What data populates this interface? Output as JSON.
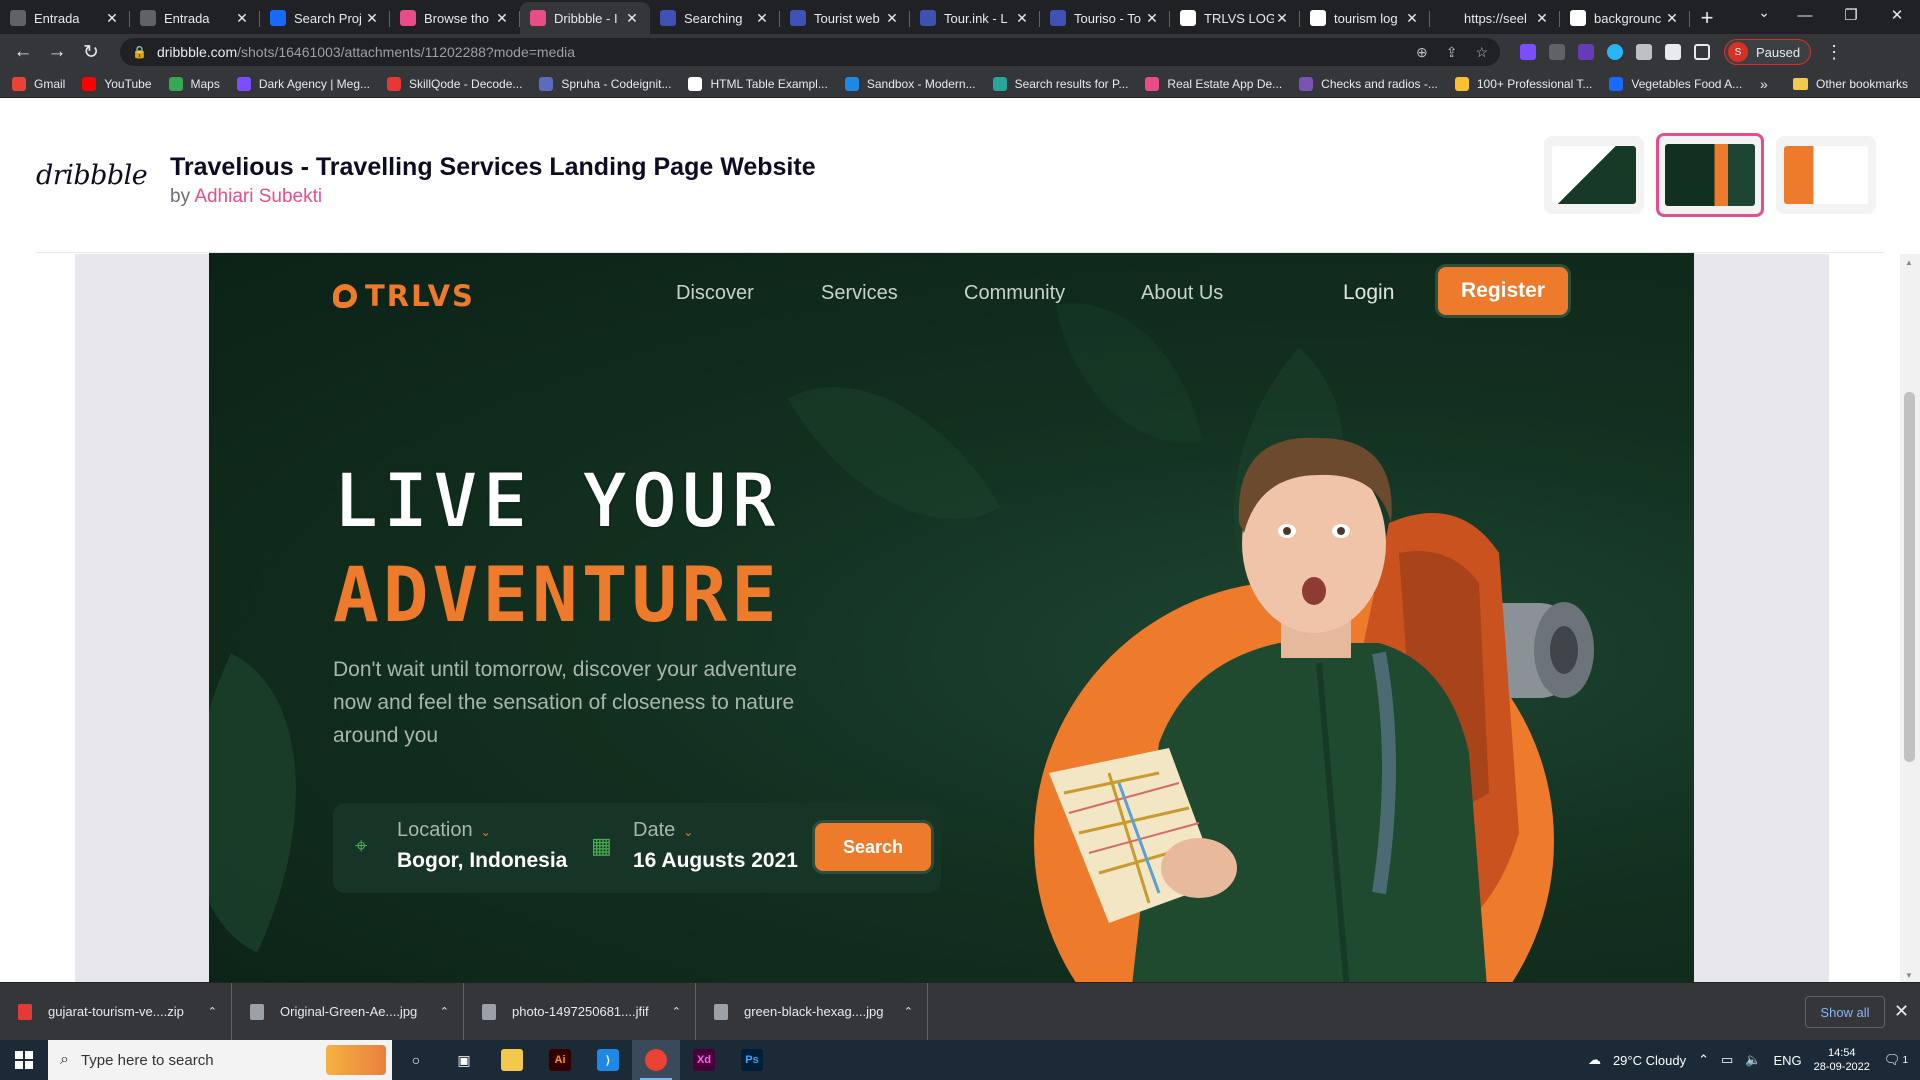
{
  "browser": {
    "tabs": [
      {
        "title": "Entrada",
        "icon": "threads-icon",
        "color": "#5f6368"
      },
      {
        "title": "Entrada",
        "icon": "threads-icon",
        "color": "#5f6368"
      },
      {
        "title": "Search Proj",
        "icon": "behance-icon",
        "color": "#1769ff"
      },
      {
        "title": "Browse tho",
        "icon": "dribbble-icon",
        "color": "#ea4c89"
      },
      {
        "title": "Dribbble - I",
        "icon": "dribbble-icon",
        "color": "#ea4c89"
      },
      {
        "title": "Searching",
        "icon": "vp-icon",
        "color": "#3f51b5"
      },
      {
        "title": "Tourist web",
        "icon": "vp-icon",
        "color": "#3f51b5"
      },
      {
        "title": "Tour.ink - L",
        "icon": "vp-icon",
        "color": "#3f51b5"
      },
      {
        "title": "Touriso - To",
        "icon": "vp-icon",
        "color": "#3f51b5"
      },
      {
        "title": "TRLVS LOGO",
        "icon": "google-icon",
        "color": "#ffffff"
      },
      {
        "title": "tourism log",
        "icon": "google-icon",
        "color": "#ffffff"
      },
      {
        "title": "https://seel",
        "icon": "s-icon",
        "color": "#202124"
      },
      {
        "title": "backgrounc",
        "icon": "google-icon",
        "color": "#ffffff"
      }
    ],
    "active_tab_index": 4,
    "url_host": "dribbble.com",
    "url_path": "/shots/16461003/attachments/11202288?mode=media",
    "profile_label": "Paused",
    "profile_initial": "S",
    "bookmarks": [
      {
        "label": "Gmail",
        "color": "#ea4335"
      },
      {
        "label": "YouTube",
        "color": "#ff0000"
      },
      {
        "label": "Maps",
        "color": "#34a853"
      },
      {
        "label": "Dark Agency | Meg...",
        "color": "#7c4dff"
      },
      {
        "label": "SkillQode - Decode...",
        "color": "#e53935"
      },
      {
        "label": "Spruha - Codeignit...",
        "color": "#5c6bc0"
      },
      {
        "label": "HTML Table Exampl...",
        "color": "#ffffff"
      },
      {
        "label": "Sandbox - Modern...",
        "color": "#1e88e5"
      },
      {
        "label": "Search results for P...",
        "color": "#26a69a"
      },
      {
        "label": "Real Estate App De...",
        "color": "#ea4c89"
      },
      {
        "label": "Checks and radios -...",
        "color": "#7952b3"
      },
      {
        "label": "100+ Professional T...",
        "color": "#fbc02d"
      },
      {
        "label": "Vegetables Food A...",
        "color": "#1769ff"
      }
    ],
    "bookmarks_more": "»",
    "other_bookmarks": "Other bookmarks"
  },
  "dribbble": {
    "logo": "dribbble",
    "title": "Travelious - Travelling Services Landing Page Website",
    "by": "by",
    "author": "Adhiari Subekti"
  },
  "hero": {
    "brand": "TRLVS",
    "nav": [
      "Discover",
      "Services",
      "Community",
      "About Us"
    ],
    "login": "Login",
    "register": "Register",
    "headline_line1": "LIVE YOUR",
    "headline_line2": "ADVENTURE",
    "subtext": "Don't wait until tomorrow, discover your adventure now and feel the sensation of closeness to nature around you",
    "location_label": "Location",
    "location_value": "Bogor, Indonesia",
    "date_label": "Date",
    "date_value": "16 Augusts 2021",
    "search_button": "Search",
    "accent_color": "#ee7a2b",
    "background_color": "#0f2a1c"
  },
  "downloads": {
    "items": [
      {
        "name": "gujarat-tourism-ve....zip",
        "color": "#e53935"
      },
      {
        "name": "Original-Green-Ae....jpg",
        "color": "#9aa0a6"
      },
      {
        "name": "photo-1497250681....jfif",
        "color": "#9aa0a6"
      },
      {
        "name": "green-black-hexag....jpg",
        "color": "#9aa0a6"
      }
    ],
    "show_all": "Show all"
  },
  "taskbar": {
    "search_placeholder": "Type here to search",
    "weather": "29°C  Cloudy",
    "language": "ENG",
    "time": "14:54",
    "date": "28-09-2022",
    "notification_count": "1"
  }
}
